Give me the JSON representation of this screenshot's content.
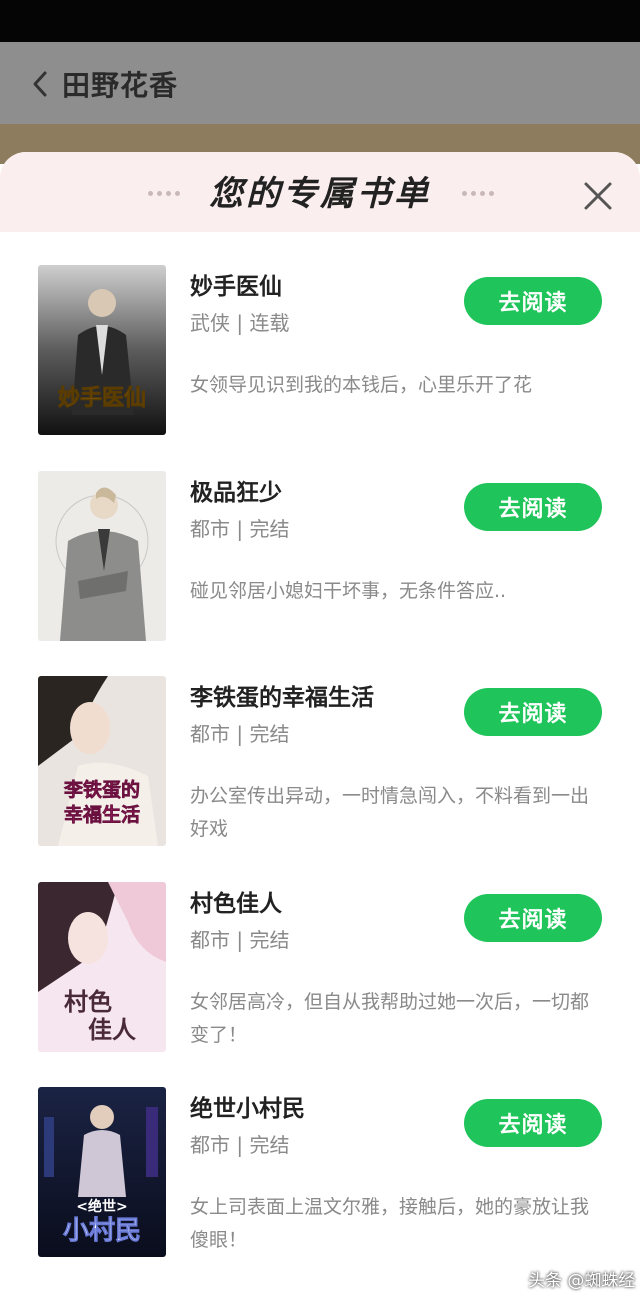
{
  "header": {
    "title": "田野花香"
  },
  "sheet": {
    "title": "您的专属书单"
  },
  "books": [
    {
      "title": "妙手医仙",
      "category": "武侠",
      "status": "连载",
      "description": "女领导见识到我的本钱后，心里乐开了花",
      "button": "去阅读",
      "cover_text": "妙手医仙"
    },
    {
      "title": "极品狂少",
      "category": "都市",
      "status": "完结",
      "description": "碰见邻居小媳妇干坏事，无条件答应..",
      "button": "去阅读",
      "cover_text": ""
    },
    {
      "title": "李铁蛋的幸福生活",
      "category": "都市",
      "status": "完结",
      "description": "办公室传出异动，一时情急闯入，不料看到一出好戏",
      "button": "去阅读",
      "cover_text": "李铁蛋的幸福生活"
    },
    {
      "title": "村色佳人",
      "category": "都市",
      "status": "完结",
      "description": "女邻居高冷，但自从我帮助过她一次后，一切都变了！",
      "button": "去阅读",
      "cover_text": "村色佳人"
    },
    {
      "title": "绝世小村民",
      "category": "都市",
      "status": "完结",
      "description": "女上司表面上温文尔雅，接触后，她的豪放让我傻眼！",
      "button": "去阅读",
      "cover_text": "绝世小村民"
    }
  ],
  "watermark": "头条 @蜘蛛经",
  "colors": {
    "accent": "#1fc55a",
    "header_bg": "#fbeeee",
    "top_bar": "#8e8e8e"
  },
  "icons": {
    "back": "chevron-left-icon",
    "close": "close-icon"
  }
}
